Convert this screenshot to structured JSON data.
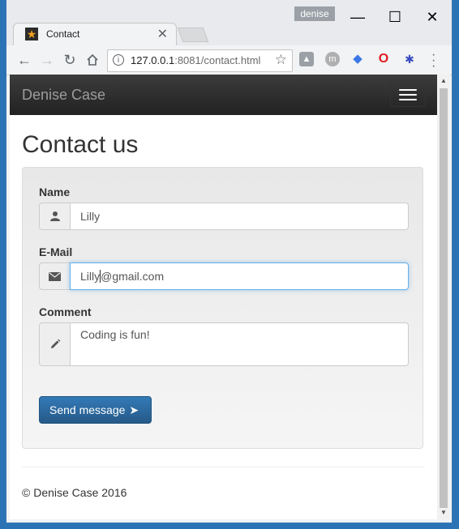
{
  "window": {
    "profile_name": "denise",
    "controls": {
      "minimize": "—",
      "maximize": "☐",
      "close": "✕"
    }
  },
  "tab": {
    "title": "Contact",
    "favicon": "star-icon",
    "close": "✕"
  },
  "toolbar": {
    "url_host": "127.0.0.1",
    "url_rest": ":8081/contact.html",
    "icons": [
      "back-icon",
      "forward-icon",
      "reload-icon",
      "home-icon",
      "info-icon",
      "bookmark-star-icon",
      "drive-icon",
      "m-icon",
      "diamond-icon",
      "opera-icon",
      "bug-icon",
      "menu-dots-icon"
    ]
  },
  "page": {
    "brand": "Denise Case",
    "heading": "Contact us",
    "form": {
      "name_label": "Name",
      "name_value": "Lilly",
      "email_label": "E-Mail",
      "email_value_before_caret": "Lilly",
      "email_value_after_caret": "@gmail.com",
      "comment_label": "Comment",
      "comment_value": "Coding is fun!",
      "submit_label": "Send message"
    },
    "footer": "© Denise Case 2016"
  },
  "colors": {
    "navbar": "#222222",
    "primary_button": "#337ab7",
    "focus_border": "#66afe9"
  }
}
